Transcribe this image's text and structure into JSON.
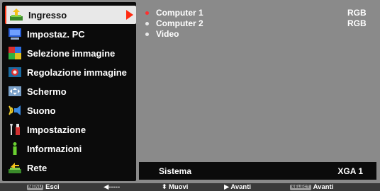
{
  "menu": {
    "items": [
      {
        "label": "Ingresso",
        "icon": "input-icon",
        "active": true
      },
      {
        "label": "Impostaz. PC",
        "icon": "pc-adjust-icon",
        "active": false
      },
      {
        "label": "Selezione immagine",
        "icon": "image-select-icon",
        "active": false
      },
      {
        "label": "Regolazione immagine",
        "icon": "image-adjust-icon",
        "active": false
      },
      {
        "label": "Schermo",
        "icon": "screen-icon",
        "active": false
      },
      {
        "label": "Suono",
        "icon": "sound-icon",
        "active": false
      },
      {
        "label": "Impostazione",
        "icon": "setting-icon",
        "active": false
      },
      {
        "label": "Informazioni",
        "icon": "information-icon",
        "active": false
      },
      {
        "label": "Rete",
        "icon": "network-icon",
        "active": false
      }
    ]
  },
  "sources": [
    {
      "name": "Computer 1",
      "mode": "RGB",
      "selected": true
    },
    {
      "name": "Computer 2",
      "mode": "RGB",
      "selected": false
    },
    {
      "name": "Video",
      "mode": "",
      "selected": false
    }
  ],
  "status": {
    "label": "Sistema",
    "value": "XGA 1"
  },
  "footer": {
    "menu_key": "MENU",
    "exit_label": "Esci",
    "back_glyph": "◀-----",
    "move_glyph": "⬍",
    "move_label": "Muovi",
    "next_glyph": "▶",
    "next_label": "Avanti",
    "select_key": "SELECT",
    "select_label": "Avanti"
  },
  "colors": {
    "accent": "#ff2a10",
    "panel_bg": "#8a8a8a",
    "menu_bg": "#0b0b0b",
    "highlight": "#e8e8e8"
  }
}
